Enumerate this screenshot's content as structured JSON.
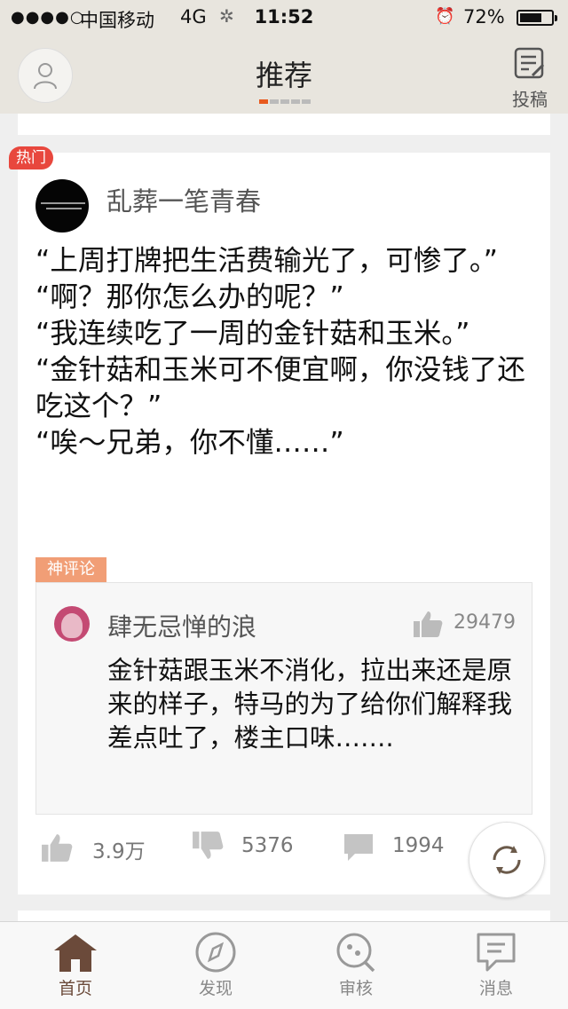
{
  "status_bar": {
    "signal": "●●●●○",
    "carrier": "中国移动",
    "network": "4G",
    "time": "11:52",
    "battery_percent": "72%",
    "battery_level": 0.72
  },
  "nav": {
    "title": "推荐",
    "submit_label": "投稿",
    "page_count": 5,
    "active_page": 0,
    "accent_color": "#e85a1e"
  },
  "post": {
    "badge": "热门",
    "author": "乱葬一笔青春",
    "content_lines": [
      "“上周打牌把生活费输光了，可惨了。”",
      "“啊？那你怎么办的呢？”",
      "“我连续吃了一周的金针菇和玉米。”",
      "“金针菇和玉米可不便宜啊，你没钱了还吃这个？”",
      "“唉～兄弟，你不懂……”"
    ],
    "god_comment": {
      "tag": "神评论",
      "user": "肆无忌惮的浪",
      "likes": "29479",
      "text": "金针菇跟玉米不消化，拉出来还是原来的样子，特马的为了给你们解释我差点吐了，楼主口味……."
    },
    "actions": {
      "likes": "3.9万",
      "dislikes": "5376",
      "comments": "1994"
    }
  },
  "tabs": [
    {
      "label": "首页",
      "icon": "home-icon",
      "active": true
    },
    {
      "label": "发现",
      "icon": "compass-icon",
      "active": false
    },
    {
      "label": "审核",
      "icon": "review-icon",
      "active": false
    },
    {
      "label": "消息",
      "icon": "message-icon",
      "active": false
    }
  ],
  "colors": {
    "hot_badge": "#e8473d",
    "god_comment_tag": "#f19e76",
    "header_bg": "#e8e5de",
    "active_tab": "#6b4a3a"
  }
}
